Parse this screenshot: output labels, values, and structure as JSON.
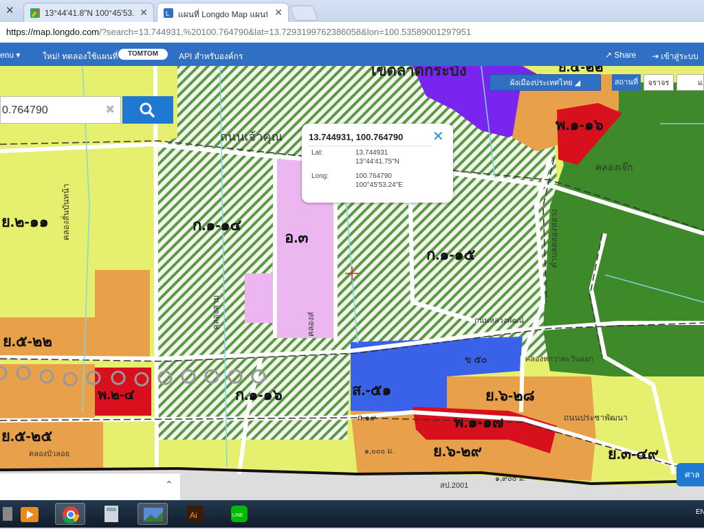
{
  "browser": {
    "tabs": [
      {
        "label": "13°44'41.8\"N 100°45'53.",
        "active": false
      },
      {
        "label": "แผนที่ Longdo Map แผนที่",
        "active": true
      }
    ],
    "url_host": "https://map.longdo.com",
    "url_rest": "/?search=13.744931,%20100.764790&lat=13.7293199762386058&lon=100.53589001297951"
  },
  "site_header": {
    "menu_label": "enu ▾",
    "promo_label": "ใหม่! ทดลองใช้แผนที่",
    "tomtom_label": "TOMTOM",
    "api_label": "API สำหรับองค์กร",
    "share_label": "Share",
    "login_label": "เข้าสู่ระบบ"
  },
  "map_controls": {
    "province_label": "ผังเมืองประเทศไทย",
    "place_label": "สถานที่",
    "traffic_label": "จราจร",
    "maptype_label": "แ"
  },
  "search": {
    "value": "0.764790",
    "placeholder": ""
  },
  "popup": {
    "title": "13.744931, 100.764790",
    "lat_label": "Lat:",
    "lat_decimal": "13.744931",
    "lat_dms": "13°44'41.75\"N",
    "long_label": "Long:",
    "long_decimal": "100.764790",
    "long_dms": "100°45'53.24\"E"
  },
  "map_labels": {
    "zone_k114": "ก.๑-๑๔",
    "zone_o3": "อ.๓",
    "zone_k115": "ก.๑-๑๕",
    "zone_y211": "ย.๒-๑๑",
    "zone_y522": "ย.๕-๒๒",
    "zone_y525": "ย.๕-๒๕",
    "zone_p24": "พ.๒-๔",
    "zone_k116": "ก.๑-๑๖",
    "zone_s51": "ส.-๕๑",
    "zone_y628": "ย.๖-๒๘",
    "zone_p117": "พ.๑-๑๗",
    "zone_y629": "ย.๖-๒๙",
    "zone_y349": "ย.๓-๔๙",
    "zone_p116": "พ.๑-๑๖",
    "zone_y522b": "ย.๕-๒๒",
    "zone_k119": "ก.๑๙",
    "zone_s50": "ข ๕๐",
    "road_chao_khun": "ถนนเจ้าคุณ",
    "khlong_jek": "คลองเจ๊ก",
    "khlong_bua_loi": "คลองบัวลอย",
    "khlong_hok_wa": "คลองหกวาตะวันออก",
    "khlong_song": "คลองส่",
    "khlong_sam": "คลองสาม",
    "khlong_sang": "คลองสั่นบันหน้า",
    "mae_lat": "เขตลาดกระบัง",
    "pracha_phatthana": "ถนนประชาพัฒนา",
    "district_label": "ตำบลคลองหลวง",
    "area_1000": "๑,๐๐๐ ม.",
    "area_1900": "๑,๙๐๐ ม.",
    "route_sp2001": "สป.2001",
    "kok_label": "ย.๕-๒๒",
    "kok_road": "ถนนหลวงพัฒน์"
  },
  "right_tab_label": "ศาล",
  "taskbar": {
    "lang": "EN"
  },
  "colors": {
    "yellow_zone": "#e6ef6e",
    "orange_zone": "#e8a04a",
    "red_zone": "#d8101e",
    "green_zone": "#3e8a2b",
    "purple_zone": "#7a24f0",
    "blue_zone": "#3a62e8",
    "pink_zone": "#ecb6f0",
    "hatch_green": "#4a8f3a",
    "brand_blue": "#2f6fc4"
  }
}
